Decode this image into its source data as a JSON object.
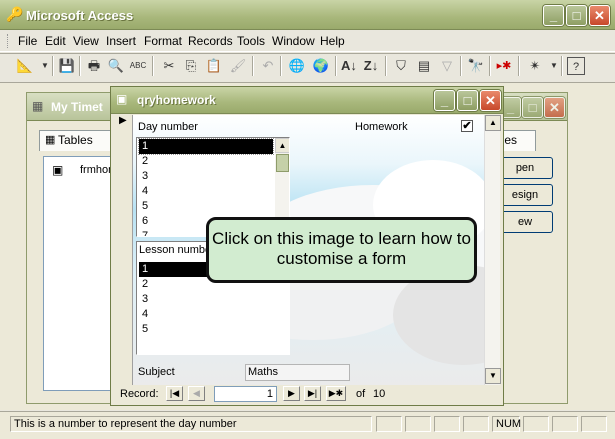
{
  "app": {
    "title": "Microsoft Access"
  },
  "menu": [
    "File",
    "Edit",
    "View",
    "Insert",
    "Format",
    "Records",
    "Tools",
    "Window",
    "Help"
  ],
  "db_window": {
    "title": "My Timet",
    "tab_tables": "Tables",
    "tab_modules": "ules",
    "item": "frmhon",
    "buttons": {
      "open": "pen",
      "design": "esign",
      "new": "ew"
    }
  },
  "form": {
    "title": "qryhomework",
    "day_number_label": "Day number",
    "homework_label": "Homework",
    "day_numbers": [
      "1",
      "2",
      "3",
      "4",
      "5",
      "6",
      "7"
    ],
    "lesson_number_label": "Lesson numbe",
    "lesson_numbers": [
      "1",
      "2",
      "3",
      "4",
      "5"
    ],
    "subject_label": "Subject",
    "subject_value": "Maths",
    "record_label": "Record:",
    "record_current": "1",
    "record_of": "of",
    "record_total": "10",
    "homework_checked": true
  },
  "callout": {
    "text": "Click on this image to learn how to customise a form"
  },
  "status": {
    "text": "This is a number to represent the day number",
    "num": "NUM"
  }
}
